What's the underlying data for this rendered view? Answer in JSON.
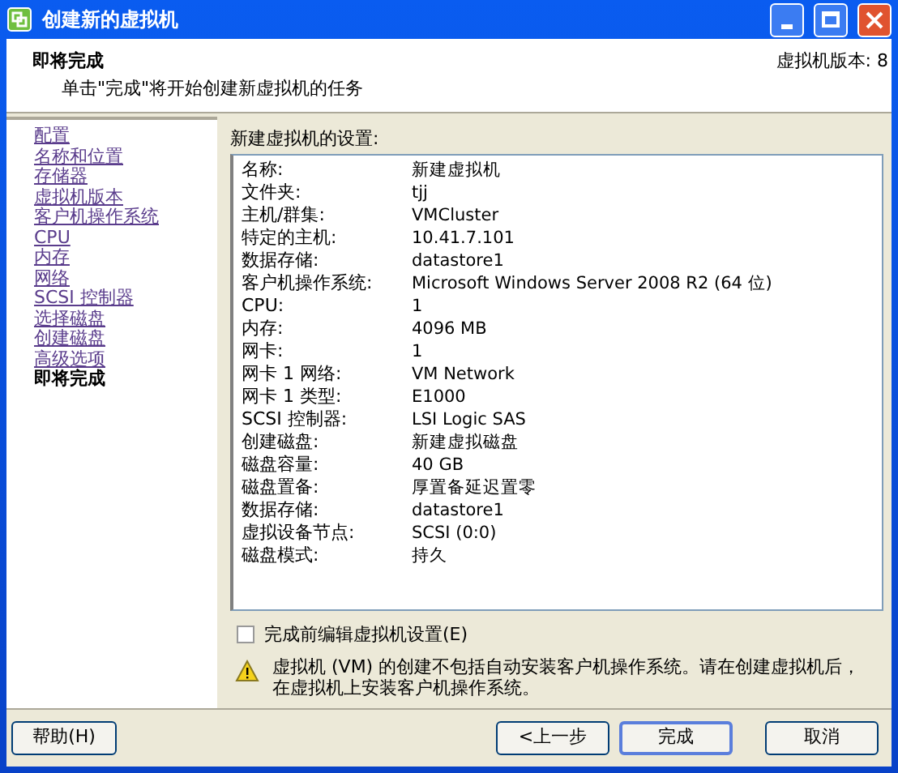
{
  "window": {
    "title": "创建新的虚拟机"
  },
  "header": {
    "title": "即将完成",
    "subtitle": "单击\"完成\"将开始创建新虚拟机的任务",
    "version": "虚拟机版本: 8"
  },
  "sidebar": {
    "items": [
      {
        "label": "配置",
        "selected": false
      },
      {
        "label": "名称和位置",
        "selected": false
      },
      {
        "label": "存储器",
        "selected": false
      },
      {
        "label": "虚拟机版本",
        "selected": false
      },
      {
        "label": "客户机操作系统",
        "selected": false
      },
      {
        "label": "CPU",
        "selected": false
      },
      {
        "label": "内存",
        "selected": false
      },
      {
        "label": "网络",
        "selected": false
      },
      {
        "label": "SCSI 控制器",
        "selected": false
      },
      {
        "label": "选择磁盘",
        "selected": false
      },
      {
        "label": "创建磁盘",
        "selected": false
      },
      {
        "label": "高级选项",
        "selected": false
      },
      {
        "label": "即将完成",
        "selected": true
      }
    ]
  },
  "settings": {
    "title": "新建虚拟机的设置:",
    "rows": [
      {
        "name": "名称:",
        "value": "新建虚拟机"
      },
      {
        "name": "文件夹:",
        "value": "tjj"
      },
      {
        "name": "主机/群集:",
        "value": "VMCluster"
      },
      {
        "name": "特定的主机:",
        "value": "10.41.7.101"
      },
      {
        "name": "数据存储:",
        "value": "datastore1"
      },
      {
        "name": "客户机操作系统:",
        "value": "Microsoft Windows Server 2008 R2 (64 位)"
      },
      {
        "name": "CPU:",
        "value": "1"
      },
      {
        "name": "内存:",
        "value": "4096 MB"
      },
      {
        "name": "网卡:",
        "value": "1"
      },
      {
        "name": "网卡 1 网络:",
        "value": "VM Network"
      },
      {
        "name": "网卡 1 类型:",
        "value": "E1000"
      },
      {
        "name": "SCSI 控制器:",
        "value": "LSI Logic SAS"
      },
      {
        "name": "创建磁盘:",
        "value": "新建虚拟磁盘"
      },
      {
        "name": "磁盘容量:",
        "value": "40 GB"
      },
      {
        "name": "磁盘置备:",
        "value": "厚置备延迟置零"
      },
      {
        "name": "数据存储:",
        "value": "datastore1"
      },
      {
        "name": "虚拟设备节点:",
        "value": "SCSI (0:0)"
      },
      {
        "name": "磁盘模式:",
        "value": "持久"
      }
    ]
  },
  "edit_checkbox": {
    "label": "完成前编辑虚拟机设置(E)",
    "checked": false
  },
  "warning": "虚拟机 (VM) 的创建不包括自动安装客户机操作系统。请在创建虚拟机后，在虚拟机上安装客户机操作系统。",
  "buttons": {
    "help": "帮助(H)",
    "back": "<上一步",
    "finish": "完成",
    "cancel": "取消"
  }
}
